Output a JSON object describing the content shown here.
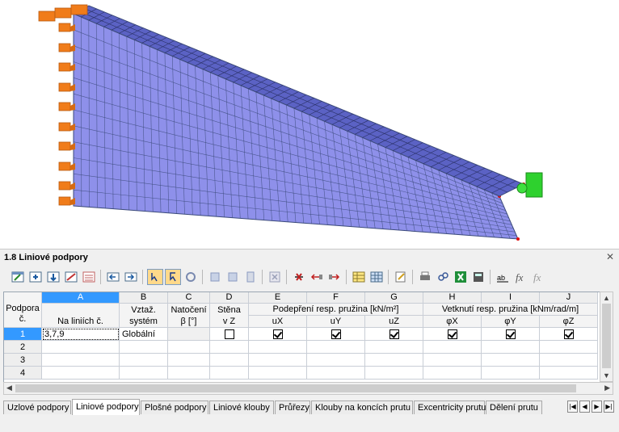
{
  "panel": {
    "title": "1.8 Liniové podpory",
    "close_icon": "close-icon"
  },
  "toolbar": {
    "icons": [
      "table-edit-icon",
      "insert-row-icon",
      "delete-row-icon",
      "clear-table-icon",
      "view-icon",
      "previous-table-icon",
      "next-table-icon",
      "select-icon",
      "select-multiple-icon",
      "refresh-icon",
      "jump-to-icon",
      "filter-icon",
      "graphics-icon",
      "delete-icon",
      "import-icon",
      "export-icon",
      "table-settings-icon",
      "column-settings-icon",
      "edit-icon",
      "table-view-icon",
      "formula-icon",
      "excel-icon",
      "calculator-icon",
      "text-ab-icon",
      "function-icon",
      "delete-function-icon"
    ]
  },
  "table": {
    "corner": {
      "line1": "Podpora",
      "line2": "č."
    },
    "columns": [
      {
        "letter": "A",
        "line1": "",
        "line2": "Na liniích č."
      },
      {
        "letter": "B",
        "line1": "Vztaž.",
        "line2": "systém"
      },
      {
        "letter": "C",
        "line1": "Natočení",
        "line2": "β [°]"
      },
      {
        "letter": "D",
        "line1": "Stěna",
        "line2": "v Z"
      },
      {
        "letter": "E",
        "line1": "",
        "line2": "uX"
      },
      {
        "letter": "F",
        "line1": "",
        "line2": "uY"
      },
      {
        "letter": "G",
        "line1": "",
        "line2": "uZ"
      },
      {
        "letter": "H",
        "line1": "",
        "line2": "φX"
      },
      {
        "letter": "I",
        "line1": "",
        "line2": "φY"
      },
      {
        "letter": "J",
        "line1": "",
        "line2": "φZ"
      }
    ],
    "group_headers": {
      "support": "Podepření resp. pružina [kN/m²]",
      "restraint": "Vetknutí resp. pružina [kNm/rad/m]"
    },
    "rows": [
      {
        "no": "1",
        "lines": "3,7,9",
        "system": "Globální",
        "rotation": "",
        "wall": false,
        "ux": true,
        "uy": true,
        "uz": true,
        "phx": true,
        "phy": true,
        "phz": true
      },
      {
        "no": "2",
        "lines": "",
        "system": "",
        "rotation": "",
        "wall": null,
        "ux": null,
        "uy": null,
        "uz": null,
        "phx": null,
        "phy": null,
        "phz": null
      },
      {
        "no": "3",
        "lines": "",
        "system": "",
        "rotation": "",
        "wall": null,
        "ux": null,
        "uy": null,
        "uz": null,
        "phx": null,
        "phy": null,
        "phz": null
      },
      {
        "no": "4",
        "lines": "",
        "system": "",
        "rotation": "",
        "wall": null,
        "ux": null,
        "uy": null,
        "uz": null,
        "phx": null,
        "phy": null,
        "phz": null
      }
    ]
  },
  "tabs": [
    {
      "label": "Uzlové podpory",
      "active": false
    },
    {
      "label": "Liniové podpory",
      "active": true
    },
    {
      "label": "Plošné podpory",
      "active": false
    },
    {
      "label": "Liniové klouby",
      "active": false
    },
    {
      "label": "Průřezy",
      "active": false
    },
    {
      "label": "Klouby na koncích prutu",
      "active": false
    },
    {
      "label": "Excentricity prutu",
      "active": false
    },
    {
      "label": "Dělení prutu",
      "active": false
    }
  ],
  "colors": {
    "mesh_fill": "#8e90ea",
    "mesh_line": "#3b4a7a",
    "support_orange": "#f07c1a",
    "support_green": "#2ed12e",
    "selection": "#3399ff"
  }
}
